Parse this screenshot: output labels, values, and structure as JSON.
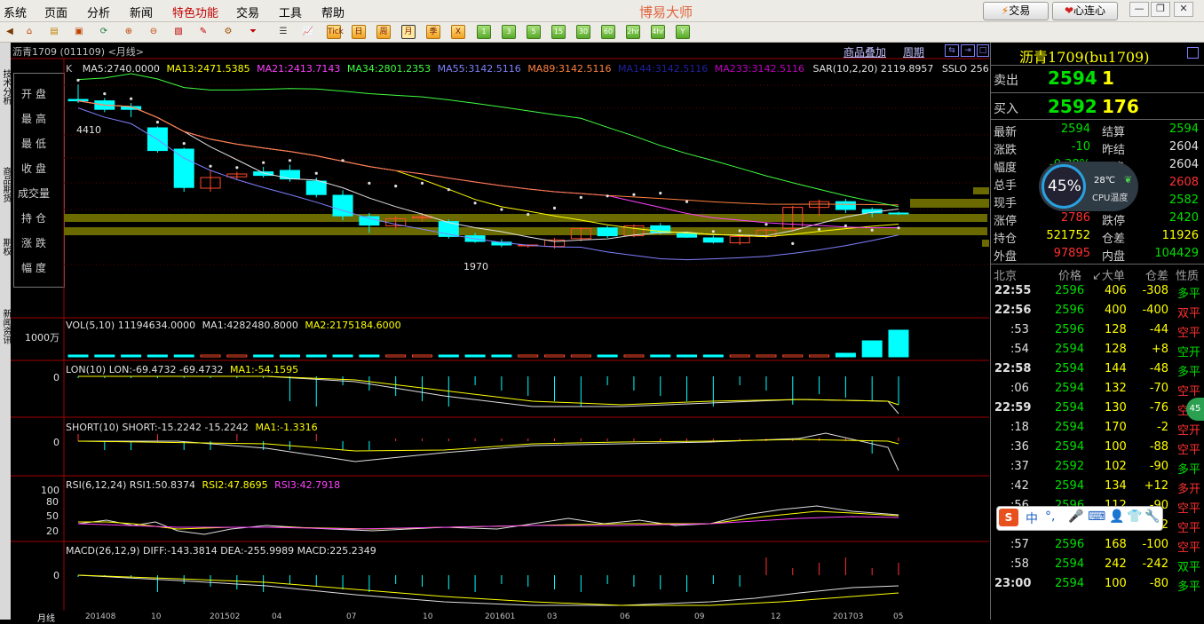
{
  "menu": {
    "items": [
      "系统",
      "页面",
      "分析",
      "新闻",
      "特色功能",
      "交易",
      "工具",
      "帮助"
    ],
    "app_title": "博易大师",
    "trade_btn": "交易",
    "heart_btn": "心连心"
  },
  "toolbar": {
    "period_labels": [
      "日",
      "周",
      "月",
      "季",
      "1",
      "3",
      "5",
      "15",
      "30",
      "60",
      "2hr",
      "4hr",
      "Y"
    ],
    "tick_label": "Tick"
  },
  "chart": {
    "instrument": "沥青1709",
    "code": "(011109)",
    "period": "<月线>",
    "overlay_link": "商品叠加",
    "period_link": "周期",
    "ma_line": {
      "prefix": "K",
      "ma5": "MA5:2740.0000",
      "ma13": "MA13:2471.5385",
      "ma21": "MA21:2413.7143",
      "ma34": "MA34:2801.2353",
      "ma55": "MA55:3142.5116",
      "ma89": "MA89:3142.5116",
      "ma144": "MA144:3142.5116",
      "ma233": "MA233:3142.5116",
      "sar": "SAR(10,2,20) 2119.8957",
      "sslo": "SSLO 2561.0"
    },
    "ohlc_labels": [
      "开盘",
      "最高",
      "最低",
      "收盘",
      "成交量",
      "持仓",
      "涨跌",
      "幅度"
    ],
    "high_label": "4410",
    "low_label": "1970",
    "vol": {
      "line": "VOL(5,10) 11194634.0000",
      "ma1": "MA1:4282480.8000",
      "ma2": "MA2:2175184.6000",
      "axis": "1000万"
    },
    "lon": {
      "line": "LON(10) LON:-69.4732 -69.4732",
      "ma1": "MA1:-54.1595",
      "axis": "0"
    },
    "short": {
      "line": "SHORT(10) SHORT:-15.2242 -15.2242",
      "ma1": "MA1:-1.3316",
      "axis": "0"
    },
    "rsi": {
      "line": "RSI(6,12,24) RSI1:50.8374",
      "rsi2": "RSI2:47.8695",
      "rsi3": "RSI3:42.7918",
      "axis": [
        "100",
        "80",
        "50",
        "20"
      ]
    },
    "macd": {
      "line": "MACD(26,12,9) DIFF:-143.3814 DEA:-255.9989 MACD:225.2349",
      "axis": "0"
    },
    "xaxis": [
      "月线",
      "201408",
      "10",
      "201502",
      "04",
      "07",
      "10",
      "201601",
      "03",
      "06",
      "09",
      "12",
      "201703",
      "05"
    ]
  },
  "chart_data": {
    "type": "candlestick",
    "candles": [
      {
        "o": 4200,
        "h": 4410,
        "l": 4150,
        "c": 4180
      },
      {
        "o": 4180,
        "h": 4220,
        "l": 4020,
        "c": 4060
      },
      {
        "o": 4100,
        "h": 4150,
        "l": 3950,
        "c": 4060
      },
      {
        "o": 3800,
        "h": 3820,
        "l": 3450,
        "c": 3480
      },
      {
        "o": 3500,
        "h": 3520,
        "l": 2900,
        "c": 2960
      },
      {
        "o": 2950,
        "h": 3200,
        "l": 2900,
        "c": 3100
      },
      {
        "o": 3110,
        "h": 3180,
        "l": 3070,
        "c": 3150
      },
      {
        "o": 3180,
        "h": 3250,
        "l": 3100,
        "c": 3130
      },
      {
        "o": 3200,
        "h": 3280,
        "l": 3040,
        "c": 3080
      },
      {
        "o": 3050,
        "h": 3100,
        "l": 2820,
        "c": 2860
      },
      {
        "o": 2850,
        "h": 2920,
        "l": 2500,
        "c": 2560
      },
      {
        "o": 2550,
        "h": 2600,
        "l": 2320,
        "c": 2430
      },
      {
        "o": 2420,
        "h": 2560,
        "l": 2380,
        "c": 2520
      },
      {
        "o": 2530,
        "h": 2600,
        "l": 2480,
        "c": 2550
      },
      {
        "o": 2480,
        "h": 2510,
        "l": 2240,
        "c": 2270
      },
      {
        "o": 2280,
        "h": 2320,
        "l": 2180,
        "c": 2200
      },
      {
        "o": 2190,
        "h": 2230,
        "l": 2120,
        "c": 2150
      },
      {
        "o": 2140,
        "h": 2160,
        "l": 2110,
        "c": 2150
      },
      {
        "o": 2130,
        "h": 2250,
        "l": 2100,
        "c": 2220
      },
      {
        "o": 2240,
        "h": 2400,
        "l": 2200,
        "c": 2380
      },
      {
        "o": 2390,
        "h": 2420,
        "l": 2250,
        "c": 2280
      },
      {
        "o": 2280,
        "h": 2440,
        "l": 2260,
        "c": 2420
      },
      {
        "o": 2420,
        "h": 2460,
        "l": 2300,
        "c": 2320
      },
      {
        "o": 2310,
        "h": 2340,
        "l": 2250,
        "c": 2260
      },
      {
        "o": 2250,
        "h": 2280,
        "l": 2170,
        "c": 2190
      },
      {
        "o": 2180,
        "h": 2290,
        "l": 2150,
        "c": 2270
      },
      {
        "o": 2270,
        "h": 2380,
        "l": 2240,
        "c": 2360
      },
      {
        "o": 2380,
        "h": 2700,
        "l": 2350,
        "c": 2680
      },
      {
        "o": 2680,
        "h": 2790,
        "l": 2550,
        "c": 2760
      },
      {
        "o": 2760,
        "h": 2800,
        "l": 2600,
        "c": 2650
      },
      {
        "o": 2650,
        "h": 2680,
        "l": 2540,
        "c": 2600
      },
      {
        "o": 2600,
        "h": 2620,
        "l": 2570,
        "c": 2594
      }
    ],
    "ylim": [
      1850,
      4500
    ],
    "upcolor": "#ff4a2a",
    "downcolor": "#00ffff"
  },
  "quote": {
    "title": "沥青1709(bu1709)",
    "sell_label": "卖出",
    "sell_price": "2594",
    "sell_qty": "1",
    "buy_label": "买入",
    "buy_price": "2592",
    "buy_qty": "176",
    "rows": [
      {
        "l1": "最新",
        "v1": "2594",
        "c1": "green",
        "l2": "结算",
        "v2": "2594",
        "c2": "green"
      },
      {
        "l1": "涨跌",
        "v1": "-10",
        "c1": "green",
        "l2": "昨结",
        "v2": "2604",
        "c2": "white"
      },
      {
        "l1": "幅度",
        "v1": "-0.38%",
        "c1": "green",
        "l2": "开盘",
        "v2": "2604",
        "c2": "white"
      },
      {
        "l1": "总手",
        "v1": "",
        "c1": "white",
        "l2": "最高",
        "v2": "2608",
        "c2": "red"
      },
      {
        "l1": "现手",
        "v1": "",
        "c1": "white",
        "l2": "最低",
        "v2": "2582",
        "c2": "green"
      },
      {
        "l1": "涨停",
        "v1": "2786",
        "c1": "red",
        "l2": "跌停",
        "v2": "2420",
        "c2": "green"
      },
      {
        "l1": "持仓",
        "v1": "521752",
        "c1": "yellow",
        "l2": "仓差",
        "v2": "11926",
        "c2": "yellow"
      },
      {
        "l1": "外盘",
        "v1": "97895",
        "c1": "red",
        "l2": "内盘",
        "v2": "104429",
        "c2": "green"
      }
    ],
    "cpu": {
      "pct": "45%",
      "temp": "28℃",
      "label": "CPU温度"
    },
    "header": {
      "city": "北京",
      "price": "价格",
      "vol": "↙大单",
      "oi": "仓差",
      "nature": "性质"
    },
    "trades": [
      {
        "t": "22:55",
        "p": "2596",
        "v": "406",
        "d": "-308",
        "n": "多平",
        "nc": "green"
      },
      {
        "t": "22:56",
        "p": "2596",
        "v": "400",
        "d": "-400",
        "n": "双平",
        "nc": "red"
      },
      {
        "t": ":53",
        "p": "2596",
        "v": "128",
        "d": "-44",
        "n": "空平",
        "nc": "red"
      },
      {
        "t": ":54",
        "p": "2594",
        "v": "128",
        "d": "+8",
        "n": "空开",
        "nc": "green"
      },
      {
        "t": "22:58",
        "p": "2594",
        "v": "144",
        "d": "-48",
        "n": "多平",
        "nc": "green"
      },
      {
        "t": ":06",
        "p": "2594",
        "v": "132",
        "d": "-70",
        "n": "空平",
        "nc": "red"
      },
      {
        "t": "22:59",
        "p": "2594",
        "v": "130",
        "d": "-76",
        "n": "空平",
        "nc": "red"
      },
      {
        "t": ":18",
        "p": "2594",
        "v": "170",
        "d": "-2",
        "n": "空开",
        "nc": "red"
      },
      {
        "t": ":36",
        "p": "2594",
        "v": "100",
        "d": "-88",
        "n": "空平",
        "nc": "red"
      },
      {
        "t": ":37",
        "p": "2592",
        "v": "102",
        "d": "-90",
        "n": "多平",
        "nc": "green"
      },
      {
        "t": ":42",
        "p": "2594",
        "v": "134",
        "d": "+12",
        "n": "多开",
        "nc": "red"
      },
      {
        "t": ":56",
        "p": "2596",
        "v": "112",
        "d": "-90",
        "n": "空平",
        "nc": "red"
      },
      {
        "t": ":57",
        "p": "2596",
        "v": "128",
        "d": "-82",
        "n": "空平",
        "nc": "red"
      },
      {
        "t": ":57",
        "p": "2596",
        "v": "168",
        "d": "-100",
        "n": "空平",
        "nc": "red"
      },
      {
        "t": ":58",
        "p": "2594",
        "v": "242",
        "d": "-242",
        "n": "双平",
        "nc": "green"
      },
      {
        "t": "23:00",
        "p": "2594",
        "v": "100",
        "d": "-80",
        "n": "多平",
        "nc": "green"
      }
    ]
  }
}
